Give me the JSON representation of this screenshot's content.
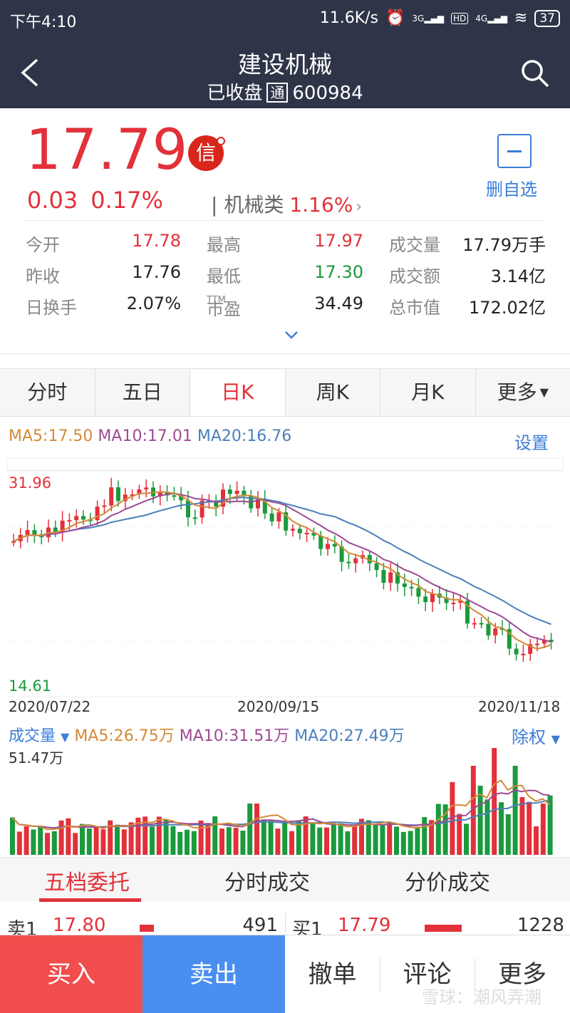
{
  "status_bar": {
    "time": "下午4:10",
    "speed": "11.6K/s",
    "battery": "37",
    "net1": "3G",
    "hd": "HD",
    "net2": "4G"
  },
  "header": {
    "title": "建设机械",
    "status": "已收盘",
    "badge": "通",
    "code": "600984"
  },
  "quote": {
    "price": "17.79",
    "xin_badge": "信",
    "change": "0.03",
    "change_pct": "0.17%",
    "sector_name": "| 机械类",
    "sector_pct": "1.16%",
    "sector_arrow": "›",
    "watchlist_label": "删自选",
    "stats": [
      {
        "label": "今开",
        "value": "17.78",
        "label2": "最高",
        "value2": "17.97",
        "label3": "成交量",
        "value3": "17.79万手"
      },
      {
        "label": "昨收",
        "value": "17.76",
        "label2": "最低",
        "value2": "17.30",
        "label3": "成交额",
        "value3": "3.14亿"
      },
      {
        "label": "日换手",
        "value": "2.07%",
        "label2": "市盈",
        "value2": "34.49",
        "label3": "总市值",
        "value3": "172.02亿"
      }
    ],
    "pe_suffix": "TTM"
  },
  "tabs": [
    "分时",
    "五日",
    "日K",
    "周K",
    "月K",
    "更多"
  ],
  "tab_more_arrow": "▼",
  "ma": {
    "ma5": "MA5:17.50",
    "ma10": "MA10:17.01",
    "ma20": "MA20:16.76",
    "settings": "设置"
  },
  "chart_labels": {
    "high": "31.96",
    "low": "14.61",
    "date_start": "2020/07/22",
    "date_mid": "2020/09/15",
    "date_end": "2020/11/18"
  },
  "volume": {
    "label": "成交量",
    "arrow": "▼",
    "ma5": "MA5:26.75万",
    "ma10": "MA10:31.51万",
    "ma20": "MA20:27.49万",
    "adjust": "除权",
    "max": "51.47万"
  },
  "colors": {
    "up": "#e2313a",
    "down": "#1a9a3c",
    "ma5": "#d38a37",
    "ma10": "#9d4a93",
    "ma20": "#4a7fbc",
    "nav": "#2e3548"
  },
  "bottom_tabs": [
    "五档委托",
    "分时成交",
    "分价成交"
  ],
  "order_book": {
    "sell_label": "卖1",
    "sell_price": "17.80",
    "sell_vol": "491",
    "buy_label": "买1",
    "buy_price": "17.79",
    "buy_vol": "1228"
  },
  "actions": {
    "buy": "买入",
    "sell": "卖出",
    "cancel": "撤单",
    "comment": "评论",
    "more": "更多"
  },
  "watermark": "雪球：潮风弄潮"
}
